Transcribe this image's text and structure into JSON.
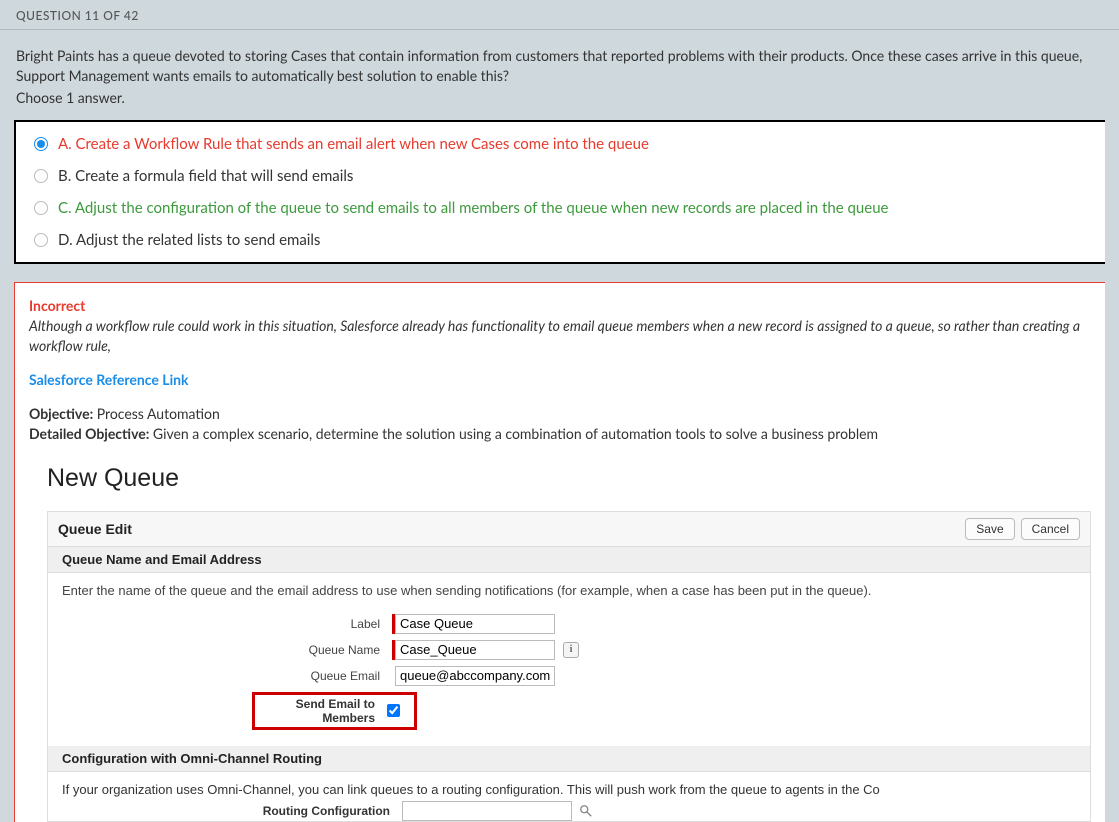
{
  "header": {
    "question_label": "QUESTION 11 OF 42"
  },
  "question": {
    "text": "Bright Paints has a queue devoted to storing Cases that contain information from customers that reported problems with their products. Once these cases arrive in this queue, Support Management wants emails to automatically best solution to enable this?",
    "choose": "Choose 1 answer."
  },
  "answers": [
    {
      "letter": "A.",
      "text": "Create a Workflow Rule that sends an email alert when new Cases come into the queue",
      "selected": true,
      "status": "incorrect"
    },
    {
      "letter": "B.",
      "text": "Create a formula field that will send emails",
      "selected": false,
      "status": "neutral"
    },
    {
      "letter": "C.",
      "text": "Adjust the configuration of the queue to send emails to all members of the queue when new records are placed in the queue",
      "selected": false,
      "status": "correct"
    },
    {
      "letter": "D.",
      "text": "Adjust the related lists to send emails",
      "selected": false,
      "status": "neutral"
    }
  ],
  "feedback": {
    "label": "Incorrect",
    "explanation": "Although a workflow rule could work in this situation, Salesforce already has functionality to email queue members when a new record is assigned to a queue, so rather than creating a workflow rule,",
    "reference_link": "Salesforce Reference Link",
    "objective_label": "Objective:",
    "objective_value": " Process Automation",
    "detailed_label": "Detailed Objective:",
    "detailed_value": " Given a complex scenario, determine the solution using a combination of automation tools to solve a business problem"
  },
  "sf": {
    "title": "New Queue",
    "edit_title": "Queue Edit",
    "save": "Save",
    "cancel": "Cancel",
    "section1_header": "Queue Name and Email Address",
    "helptext": "Enter the name of the queue and the email address to use when sending notifications (for example, when a case has been put in the queue).",
    "label_label": "Label",
    "label_value": "Case Queue",
    "queuename_label": "Queue Name",
    "queuename_value": "Case_Queue",
    "queueemail_label": "Queue Email",
    "queueemail_value": "queue@abccompany.com",
    "sendemail_label": "Send Email to Members",
    "section2_header": "Configuration with Omni-Channel Routing",
    "routing_text": "If your organization uses Omni-Channel, you can link queues to a routing configuration. This will push work from the queue to agents in the Co",
    "routing_label": "Routing Configuration",
    "info_text": "i"
  }
}
